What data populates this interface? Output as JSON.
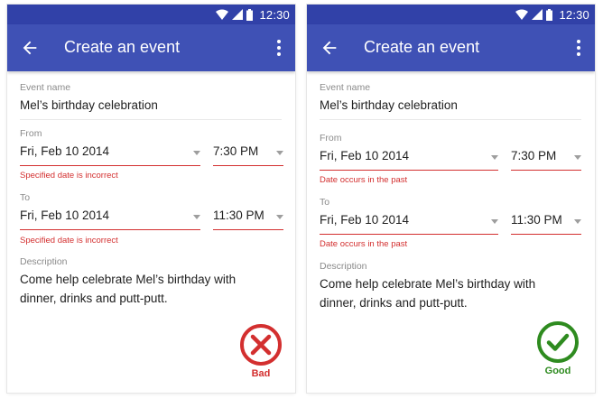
{
  "status_bar": {
    "time": "12:30"
  },
  "screens": [
    {
      "title": "Create an event",
      "event_name_label": "Event name",
      "event_name_value": "Mel’s birthday celebration",
      "from_label": "From",
      "from_date": "Fri, Feb 10 2014",
      "from_time": "7:30 PM",
      "from_error": "Specified date is incorrect",
      "to_label": "To",
      "to_date": "Fri, Feb 10 2014",
      "to_time": "11:30 PM",
      "to_error": "Specified date is incorrect",
      "description_label": "Description",
      "description_value": "Come help celebrate Mel’s birthday with dinner, drinks and putt-putt.",
      "verdict": "Bad",
      "verdict_icon": "x-circle-icon",
      "verdict_color": "#d32f2f"
    },
    {
      "title": "Create an event",
      "event_name_label": "Event name",
      "event_name_value": "Mel’s birthday celebration",
      "from_label": "From",
      "from_date": "Fri, Feb 10 2014",
      "from_time": "7:30 PM",
      "from_error": "Date occurs in the past",
      "to_label": "To",
      "to_date": "Fri, Feb 10 2014",
      "to_time": "11:30 PM",
      "to_error": "Date occurs in the past",
      "description_label": "Description",
      "description_value": "Come help celebrate Mel’s birthday with dinner, drinks and putt-putt.",
      "verdict": "Good",
      "verdict_icon": "check-circle-icon",
      "verdict_color": "#2e8b1f"
    }
  ],
  "colors": {
    "status_bar": "#3141a8",
    "app_bar": "#3f51b5",
    "error": "#d32f2f"
  }
}
